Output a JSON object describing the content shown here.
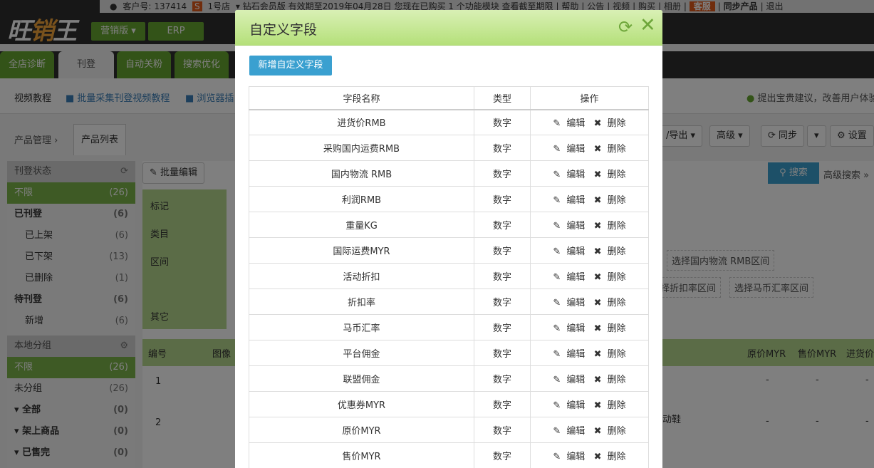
{
  "topbar": {
    "customer_prefix": "客户号:",
    "customer_id": "137414",
    "store_badge": "S",
    "store": "1号店",
    "account_info": "钻石会员版 有效期至2019年04月28日 您现在已购买 1 个功能模块 查看截至期限",
    "links": [
      "帮助",
      "公告",
      "视频",
      "购买",
      "相册"
    ],
    "kefu": "客服",
    "sync": "同步产品",
    "logout": "退出"
  },
  "logo": {
    "part1": "旺",
    "part2": "销",
    "part3": "王"
  },
  "versions": {
    "marketing": "营销版",
    "erp": "ERP"
  },
  "main_tabs": [
    "全店诊断",
    "刊登",
    "自动关粉",
    "搜索优化"
  ],
  "subnav": {
    "video": "视频教程",
    "batch_video": "批量采集刊登视频教程",
    "browser_video": "浏览器插",
    "tip": "提出宝贵建议，改善用户体验"
  },
  "crumbs": {
    "product_mgmt": "产品管理",
    "product_list": "产品列表"
  },
  "toolbar": {
    "import_export": "/导出",
    "advanced": "高级",
    "sync": "同步",
    "settings": "设置",
    "batch_edit": "批量编辑",
    "search": "搜索",
    "advanced_search": "高级搜索"
  },
  "filters": {
    "tag": "标记",
    "category": "类目",
    "range": "区间",
    "other": "其它",
    "range_chips": [
      "选择国内物流 RMB区间",
      "择折扣率区间",
      "选择马币汇率区间"
    ]
  },
  "sidebar": {
    "status_header": "刊登状态",
    "items": [
      {
        "label": "不限",
        "count": "(26)"
      },
      {
        "label": "已刊登",
        "count": "(6)"
      },
      {
        "label": "已上架",
        "count": "(6)"
      },
      {
        "label": "已下架",
        "count": "(13)"
      },
      {
        "label": "已删除",
        "count": "(1)"
      },
      {
        "label": "待刊登",
        "count": "(6)"
      },
      {
        "label": "新增",
        "count": "(6)"
      }
    ],
    "group_header": "本地分组",
    "groups": [
      {
        "label": "不限",
        "count": "(26)"
      },
      {
        "label": "未分组",
        "count": "(26)"
      },
      {
        "label": "全部",
        "count": "(0)"
      },
      {
        "label": "架上商品",
        "count": "(0)"
      },
      {
        "label": "已售完",
        "count": "(0)"
      }
    ]
  },
  "product_table": {
    "headers": [
      "编号",
      "图像",
      "原价MYR",
      "售价MYR",
      "进货价"
    ],
    "rows": [
      {
        "no": "1",
        "orig": "-",
        "sale": "-",
        "cost": "-"
      },
      {
        "no": "2",
        "orig": "-",
        "sale": "-",
        "cost": "-",
        "name_tail": "动鞋"
      }
    ]
  },
  "modal": {
    "title": "自定义字段",
    "add_button": "新增自定义字段",
    "columns": [
      "字段名称",
      "类型",
      "操作"
    ],
    "edit": "编辑",
    "delete": "删除",
    "rows": [
      {
        "name": "进货价RMB",
        "type": "数字"
      },
      {
        "name": "采购国内运费RMB",
        "type": "数字"
      },
      {
        "name": "国内物流 RMB",
        "type": "数字"
      },
      {
        "name": "利润RMB",
        "type": "数字"
      },
      {
        "name": "重量KG",
        "type": "数字"
      },
      {
        "name": "国际运费MYR",
        "type": "数字"
      },
      {
        "name": "活动折扣",
        "type": "数字"
      },
      {
        "name": "折扣率",
        "type": "数字"
      },
      {
        "name": "马币汇率",
        "type": "数字"
      },
      {
        "name": "平台佣金",
        "type": "数字"
      },
      {
        "name": "联盟佣金",
        "type": "数字"
      },
      {
        "name": "优惠券MYR",
        "type": "数字"
      },
      {
        "name": "原价MYR",
        "type": "数字"
      },
      {
        "name": "售价MYR",
        "type": "数字"
      }
    ]
  },
  "colors": {
    "green": "#67a631",
    "header_green": "#b5e07a",
    "blue": "#3aa0d0"
  }
}
